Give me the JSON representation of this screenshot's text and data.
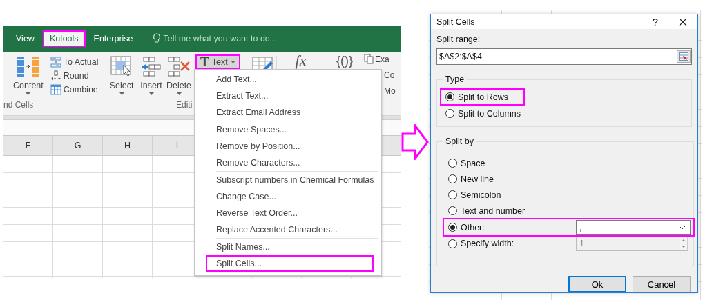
{
  "excel": {
    "tabs": [
      {
        "label": "View",
        "selected": false,
        "highlighted": false
      },
      {
        "label": "Kutools",
        "selected": true,
        "highlighted": true
      },
      {
        "label": "Enterprise",
        "selected": false,
        "highlighted": false
      }
    ],
    "tell_me": "Tell me what you want to do...",
    "ribbon": {
      "content_button": "Content",
      "small_buttons": [
        "To Actual",
        "Round",
        "Combine"
      ],
      "group_label_1": "nd Cells",
      "large_buttons": [
        "Select",
        "Insert",
        "Delete"
      ],
      "text_button": {
        "glyph": "T",
        "label": "Text",
        "highlighted": true
      },
      "group_label_2": "Editi",
      "fx_glyph": "fx",
      "formula_glyph": "{()}",
      "cut_labels": [
        "Exa",
        "Co",
        "Mo"
      ]
    },
    "columns": [
      "F",
      "G",
      "H",
      "I"
    ],
    "menu": {
      "sections": [
        {
          "items": [
            {
              "label": "Add Text...",
              "highlighted": false
            },
            {
              "label": "Extract Text...",
              "highlighted": false
            },
            {
              "label": "Extract Email Address",
              "highlighted": false
            }
          ]
        },
        {
          "items": [
            {
              "label": "Remove Spaces...",
              "highlighted": false
            },
            {
              "label": "Remove by Position...",
              "highlighted": false
            },
            {
              "label": "Remove Characters...",
              "highlighted": false
            }
          ]
        },
        {
          "items": [
            {
              "label": "Subscript numbers in Chemical Formulas",
              "highlighted": false
            },
            {
              "label": "Change Case...",
              "highlighted": false
            },
            {
              "label": "Reverse Text Order...",
              "highlighted": false
            },
            {
              "label": "Replace Accented Characters...",
              "highlighted": false
            }
          ]
        },
        {
          "items": [
            {
              "label": "Split Names...",
              "highlighted": false
            },
            {
              "label": "Split Cells...",
              "highlighted": true
            }
          ]
        }
      ]
    }
  },
  "dialog": {
    "title": "Split Cells",
    "help": "?",
    "range_label": "Split range:",
    "range_value": "$A$2:$A$4",
    "type_group": {
      "legend": "Type",
      "options": [
        {
          "label": "Split to Rows",
          "selected": true,
          "highlighted": true
        },
        {
          "label": "Split to Columns",
          "selected": false,
          "highlighted": false
        }
      ]
    },
    "split_by": {
      "legend": "Split by",
      "options": [
        {
          "kind": "plain",
          "label": "Space",
          "selected": false,
          "highlighted": false
        },
        {
          "kind": "plain",
          "label": "New line",
          "selected": false,
          "highlighted": false
        },
        {
          "kind": "plain",
          "label": "Semicolon",
          "selected": false,
          "highlighted": false
        },
        {
          "kind": "plain",
          "label": "Text and number",
          "selected": false,
          "highlighted": false
        },
        {
          "kind": "dropdown",
          "label": "Other:",
          "selected": true,
          "highlighted": true,
          "value": ","
        },
        {
          "kind": "spinner",
          "label": "Specify width:",
          "selected": false,
          "highlighted": false,
          "value": "1",
          "disabled": true
        }
      ]
    },
    "buttons": [
      {
        "label": "Ok",
        "default": true
      },
      {
        "label": "Cancel",
        "default": false
      }
    ]
  }
}
